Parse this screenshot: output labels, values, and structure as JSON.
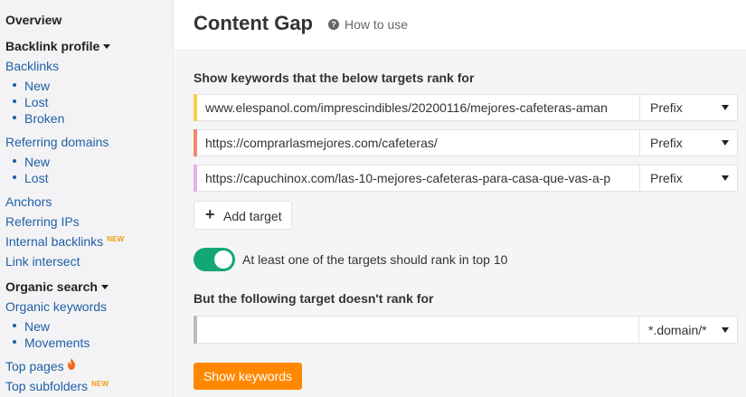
{
  "sidebar": {
    "overview": "Overview",
    "backlink_profile": "Backlink profile",
    "backlinks": "Backlinks",
    "backlinks_sub": [
      "New",
      "Lost",
      "Broken"
    ],
    "referring_domains": "Referring domains",
    "referring_domains_sub": [
      "New",
      "Lost"
    ],
    "anchors": "Anchors",
    "referring_ips": "Referring IPs",
    "internal_backlinks": "Internal backlinks",
    "link_intersect": "Link intersect",
    "organic_search": "Organic search",
    "organic_keywords": "Organic keywords",
    "organic_keywords_sub": [
      "New",
      "Movements"
    ],
    "top_pages": "Top pages",
    "top_subfolders": "Top subfolders",
    "new_badge": "NEW"
  },
  "header": {
    "title": "Content Gap",
    "how_to_use": "How to use"
  },
  "form": {
    "targets_label": "Show keywords that the below targets rank for",
    "targets": [
      {
        "url": "www.elespanol.com/imprescindibles/20200116/mejores-cafeteras-aman",
        "mode": "Prefix",
        "stripe_color": "#f7d046"
      },
      {
        "url": "https://comprarlasmejores.com/cafeteras/",
        "mode": "Prefix",
        "stripe_color": "#f08a6a"
      },
      {
        "url": "https://capuchinox.com/las-10-mejores-cafeteras-para-casa-que-vas-a-p",
        "mode": "Prefix",
        "stripe_color": "#e2b5e6"
      }
    ],
    "add_target": "Add target",
    "toggle_label": "At least one of the targets should rank in top 10",
    "toggle_on": true,
    "exclude_label": "But the following target doesn't rank for",
    "exclude_value": "",
    "exclude_mode": "*.domain/*",
    "show_button": "Show keywords"
  },
  "colors": {
    "accent": "#ff8800",
    "toggle": "#13a776",
    "link": "#1f5fa6"
  }
}
